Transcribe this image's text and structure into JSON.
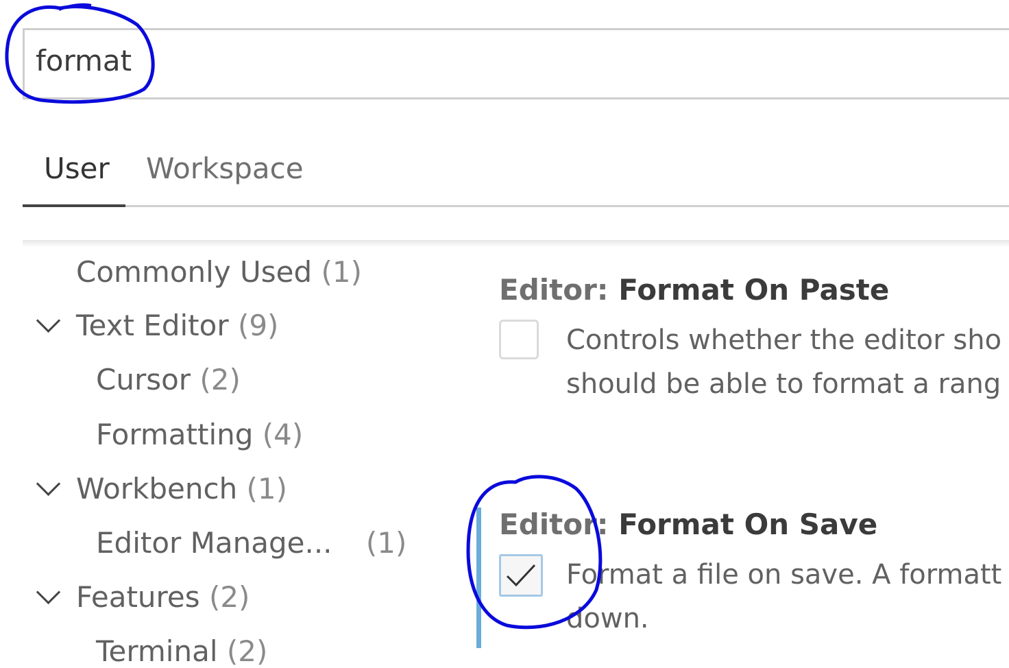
{
  "search": {
    "value": "format"
  },
  "tabs": [
    {
      "label": "User",
      "active": true
    },
    {
      "label": "Workspace",
      "active": false
    }
  ],
  "toc": [
    {
      "label": "Commonly Used",
      "count": "(1)"
    },
    {
      "label": "Text Editor",
      "count": "(9)"
    },
    {
      "label": "Cursor",
      "count": "(2)"
    },
    {
      "label": "Formatting",
      "count": "(4)"
    },
    {
      "label": "Workbench",
      "count": "(1)"
    },
    {
      "label": "Editor Manage...",
      "count": "(1)"
    },
    {
      "label": "Features",
      "count": "(2)"
    },
    {
      "label": "Terminal",
      "count": "(2)"
    }
  ],
  "settings": [
    {
      "category": "Editor: ",
      "name": "Format On Paste",
      "checked": false,
      "desc_lines": [
        "Controls whether the editor sho",
        "should be able to format a rang"
      ]
    },
    {
      "category": "Editor: ",
      "name": "Format On Save",
      "checked": true,
      "desc_lines": [
        "Format a file on save. A formatt",
        "down."
      ]
    }
  ],
  "colors": {
    "focus_accent": "#6aacda",
    "annotation_ink": "#0a0adc"
  }
}
